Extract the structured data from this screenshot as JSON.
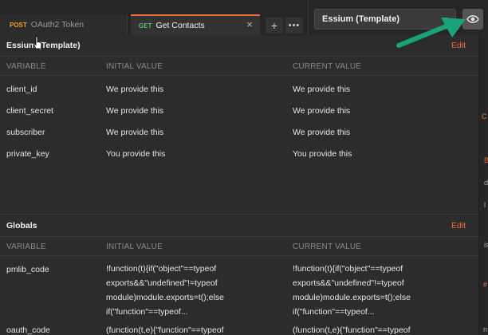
{
  "tabs": [
    {
      "method": "POST",
      "label": "OAuth2 Token"
    },
    {
      "method": "GET",
      "label": "Get Contacts"
    }
  ],
  "tab_controls": {
    "add": "+",
    "more": "•••",
    "close": "×"
  },
  "environment": {
    "selected": "Essium (Template)"
  },
  "environment_section": {
    "title": "Essium (Template)",
    "edit": "Edit",
    "columns": [
      "VARIABLE",
      "INITIAL VALUE",
      "CURRENT VALUE"
    ],
    "rows": [
      {
        "variable": "client_id",
        "initial": "We provide this",
        "current": "We provide this"
      },
      {
        "variable": "client_secret",
        "initial": "We provide this",
        "current": "We provide this"
      },
      {
        "variable": "subscriber",
        "initial": "We provide this",
        "current": "We provide this"
      },
      {
        "variable": "private_key",
        "initial": "You provide this",
        "current": "You provide this"
      }
    ]
  },
  "globals_section": {
    "title": "Globals",
    "edit": "Edit",
    "columns": [
      "VARIABLE",
      "INITIAL VALUE",
      "CURRENT VALUE"
    ],
    "rows": [
      {
        "variable": "pmlib_code",
        "initial": [
          "!function(t){if(\"object\"==typeof",
          "exports&&\"undefined\"!=typeof",
          "module)module.exports=t();else",
          "if(\"function\"==typeof..."
        ],
        "current": [
          "!function(t){if(\"object\"==typeof",
          "exports&&\"undefined\"!=typeof",
          "module)module.exports=t();else",
          "if(\"function\"==typeof..."
        ]
      },
      {
        "variable": "oauth_code",
        "initial": [
          "(function(t,e){\"function\"==typeof"
        ],
        "current": [
          "(function(t,e){\"function\"==typeof"
        ]
      }
    ]
  },
  "colors": {
    "accent": "#f26b3a",
    "get": "#4fbf68",
    "post": "#f0a030",
    "annotation_arrow": "#1aa37a"
  }
}
